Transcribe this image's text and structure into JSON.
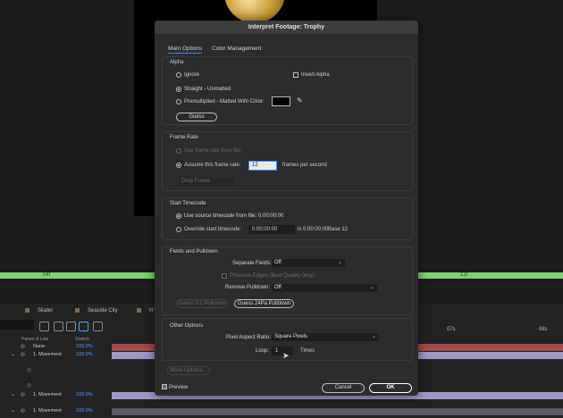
{
  "timeline": {
    "ruler_marks": [
      "04f",
      "12f"
    ],
    "tabs": [
      "Skater",
      "Seaside City",
      "NY"
    ],
    "time_marks": [
      "07s",
      "08s"
    ],
    "columns": {
      "parent": "Parent & Link",
      "stretch": "Stretch"
    },
    "layers": [
      {
        "parent": "None",
        "stretch": "100.0%"
      },
      {
        "parent": "1. Movement",
        "stretch": "100.0%"
      },
      {
        "parent": "1. Movement",
        "stretch": "100.0%"
      },
      {
        "parent": "1. Movement",
        "stretch": "100.0%"
      }
    ],
    "colors": {
      "work_area": "#7bd46e",
      "bar_red": "#a44a4a",
      "bar_purple": "#9b98c6",
      "bar_gray": "#5a5a66"
    }
  },
  "dialog": {
    "title": "Interpret Footage: Trophy",
    "tabs": [
      "Main Options",
      "Color Management"
    ],
    "alpha": {
      "title": "Alpha",
      "ignore": "Ignore",
      "invert": "Invert Alpha",
      "straight": "Straight - Unmatted",
      "premultiplied": "Premultiplied - Matted With Color:",
      "guess": "Guess",
      "matte_color": "#000000",
      "eyedropper_icon": "eyedropper-icon",
      "selected": "straight"
    },
    "frame_rate": {
      "title": "Frame Rate",
      "use_file": "Use frame rate from file:",
      "assume": "Assume this frame rate:",
      "value": "12",
      "unit": "frames per second",
      "drop_frame": "Drop Frame"
    },
    "start_timecode": {
      "title": "Start Timecode",
      "use_source": "Use source timecode from file:",
      "source_value": "0:00:00:00",
      "override": "Override start timecode:",
      "override_value": "0:00:00:00",
      "equals": "is 0:00:00:00",
      "base": "Base 12"
    },
    "fields": {
      "title": "Fields and Pulldown",
      "separate_label": "Separate Fields:",
      "separate_value": "Off",
      "preserve": "Preserve Edges (Best Quality Only)",
      "remove_label": "Remove Pulldown:",
      "remove_value": "Off",
      "guess32": "Guess 3:2 Pulldown",
      "guess24": "Guess 24Pa Pulldown"
    },
    "other": {
      "title": "Other Options",
      "par_label": "Pixel Aspect Ratio:",
      "par_value": "Square Pixels",
      "loop_label": "Loop:",
      "loop_value": "1",
      "loop_unit": "Times"
    },
    "more_options": "More Options...",
    "preview": "Preview",
    "cancel": "Cancel",
    "ok": "OK"
  }
}
